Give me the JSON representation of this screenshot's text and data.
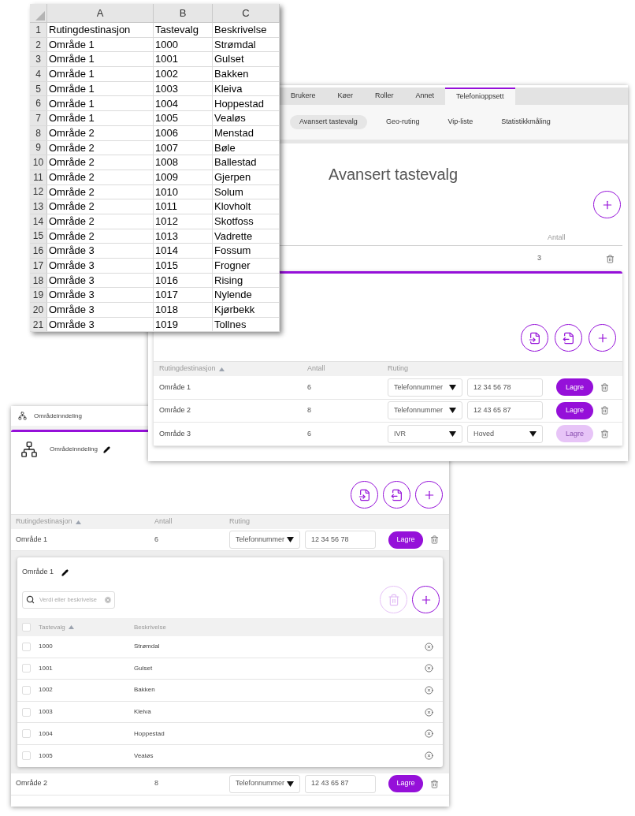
{
  "spreadsheet": {
    "column_headers": [
      "A",
      "B",
      "C"
    ],
    "rows": [
      {
        "number": "1",
        "cells": [
          "Rutingdestinasjon",
          "Tastevalg",
          "Beskrivelse"
        ]
      },
      {
        "number": "2",
        "cells": [
          "Område 1",
          "1000",
          "Strømdal"
        ]
      },
      {
        "number": "3",
        "cells": [
          "Område 1",
          "1001",
          "Gulset"
        ]
      },
      {
        "number": "4",
        "cells": [
          "Område 1",
          "1002",
          "Bakken"
        ]
      },
      {
        "number": "5",
        "cells": [
          "Område 1",
          "1003",
          "Kleiva"
        ]
      },
      {
        "number": "6",
        "cells": [
          "Område 1",
          "1004",
          "Hoppestad"
        ]
      },
      {
        "number": "7",
        "cells": [
          "Område 1",
          "1005",
          "Vealøs"
        ]
      },
      {
        "number": "8",
        "cells": [
          "Område 2",
          "1006",
          "Menstad"
        ]
      },
      {
        "number": "9",
        "cells": [
          "Område 2",
          "1007",
          "Bøle"
        ]
      },
      {
        "number": "10",
        "cells": [
          "Område 2",
          "1008",
          "Ballestad"
        ]
      },
      {
        "number": "11",
        "cells": [
          "Område 2",
          "1009",
          "Gjerpen"
        ]
      },
      {
        "number": "12",
        "cells": [
          "Område 2",
          "1010",
          "Solum"
        ]
      },
      {
        "number": "13",
        "cells": [
          "Område 2",
          "1011",
          "Klovholt"
        ]
      },
      {
        "number": "14",
        "cells": [
          "Område 2",
          "1012",
          "Skotfoss"
        ]
      },
      {
        "number": "15",
        "cells": [
          "Område 2",
          "1013",
          "Vadrette"
        ]
      },
      {
        "number": "16",
        "cells": [
          "Område 3",
          "1014",
          "Fossum"
        ]
      },
      {
        "number": "17",
        "cells": [
          "Område 3",
          "1015",
          "Frogner"
        ]
      },
      {
        "number": "18",
        "cells": [
          "Område 3",
          "1016",
          "Rising"
        ]
      },
      {
        "number": "19",
        "cells": [
          "Område 3",
          "1017",
          "Nylende"
        ]
      },
      {
        "number": "20",
        "cells": [
          "Område 3",
          "1018",
          "Kjørbekk"
        ]
      },
      {
        "number": "21",
        "cells": [
          "Område 3",
          "1019",
          "Tollnes"
        ]
      }
    ]
  },
  "settings_window": {
    "tabs": [
      {
        "label": "Brukere",
        "selected": false
      },
      {
        "label": "Køer",
        "selected": false
      },
      {
        "label": "Roller",
        "selected": false
      },
      {
        "label": "Annet",
        "selected": false
      },
      {
        "label": "Telefonioppsett",
        "selected": true
      }
    ],
    "subtabs": [
      {
        "label": "Avansert tastevalg",
        "selected": true
      },
      {
        "label": "Geo-ruting",
        "selected": false
      },
      {
        "label": "Vip-liste",
        "selected": false
      },
      {
        "label": "Statistikkmåling",
        "selected": false
      }
    ],
    "title": "Avansert tastevalg",
    "summary_table": {
      "column": "Antall",
      "rows": [
        {
          "count": "3",
          "expanded": true
        }
      ]
    },
    "routing_table": {
      "columns": [
        "Rutingdestinasjon",
        "Antall",
        "Ruting"
      ],
      "rows": [
        {
          "destination": "Område 1",
          "count": "6",
          "routing": "Telefonnummer",
          "target": {
            "kind": "input",
            "value": "12 34 56 78"
          },
          "save": "Lagre",
          "save_disabled": false
        },
        {
          "destination": "Område 2",
          "count": "8",
          "routing": "Telefonnummer",
          "target": {
            "kind": "input",
            "value": "12 43 65 87"
          },
          "save": "Lagre",
          "save_disabled": false
        },
        {
          "destination": "Område 3",
          "count": "6",
          "routing": "IVR",
          "target": {
            "kind": "select",
            "value": "Hoved"
          },
          "save": "Lagre",
          "save_disabled": true
        }
      ]
    }
  },
  "area_window": {
    "breadcrumb": "Områdeinndeling",
    "heading": "Områdeinndeling",
    "routing_table": {
      "columns": [
        "Rutingdestinasjon",
        "Antall",
        "Ruting"
      ],
      "rows": [
        {
          "destination": "Område 1",
          "count": "6",
          "routing": "Telefonnummer",
          "target": {
            "kind": "input",
            "value": "12 34 56 78"
          },
          "save": "Lagre",
          "save_disabled": false,
          "expanded": true
        },
        {
          "destination": "Område 2",
          "count": "8",
          "routing": "Telefonnummer",
          "target": {
            "kind": "input",
            "value": "12 43 65 87"
          },
          "save": "Lagre",
          "save_disabled": false,
          "expanded": false
        }
      ]
    },
    "detail": {
      "title": "Område 1",
      "search": {
        "placeholder": "Verdi eller beskrivelse"
      },
      "delete_disabled": true,
      "select_all_checked": false,
      "columns": [
        "Tastevalg",
        "Beskrivelse"
      ],
      "rows": [
        {
          "key": "1000",
          "description": "Strømdal",
          "checked": false
        },
        {
          "key": "1001",
          "description": "Gulset",
          "checked": false
        },
        {
          "key": "1002",
          "description": "Bakken",
          "checked": false
        },
        {
          "key": "1003",
          "description": "Kleiva",
          "checked": false
        },
        {
          "key": "1004",
          "description": "Hoppestad",
          "checked": false
        },
        {
          "key": "1005",
          "description": "Vealøs",
          "checked": false
        }
      ]
    }
  }
}
